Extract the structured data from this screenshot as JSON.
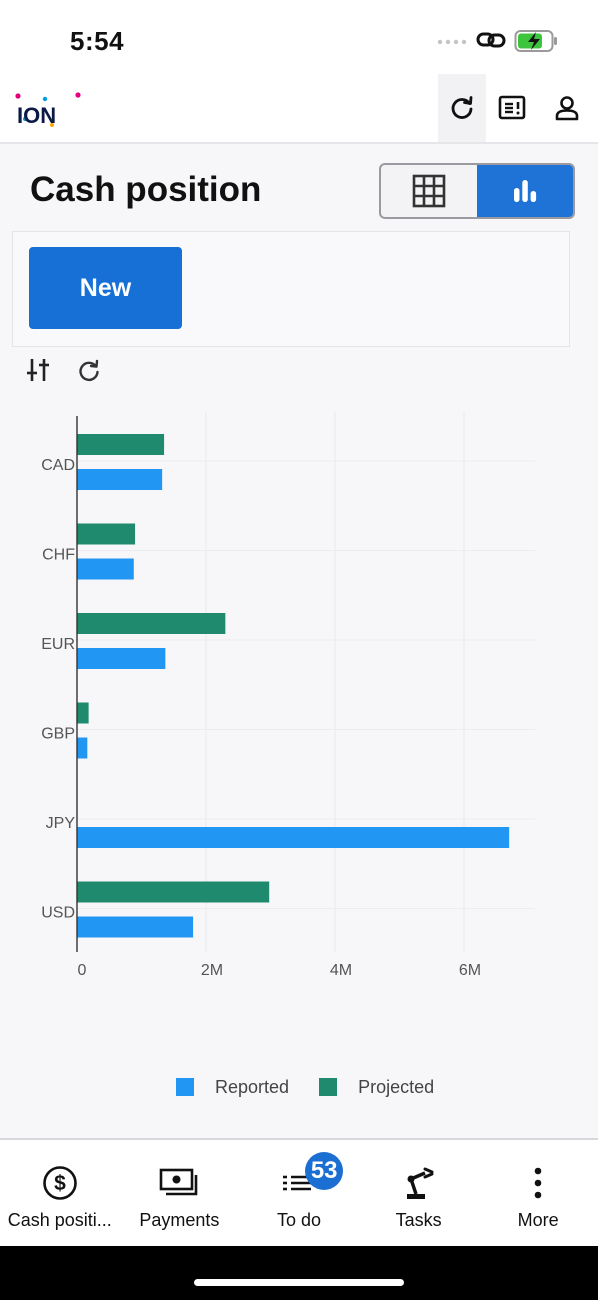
{
  "status": {
    "time": "5:54"
  },
  "header": {
    "logo_text": "ION"
  },
  "page": {
    "title": "Cash position",
    "new_label": "New"
  },
  "colors": {
    "reported": "#2196f3",
    "projected": "#1f8a6e",
    "accent": "#1670d6"
  },
  "chart_data": {
    "type": "bar",
    "orientation": "horizontal",
    "categories": [
      "CAD",
      "CHF",
      "EUR",
      "GBP",
      "JPY",
      "USD"
    ],
    "series": [
      {
        "name": "Projected",
        "values": [
          1350000,
          900000,
          2300000,
          180000,
          0,
          2980000
        ]
      },
      {
        "name": "Reported",
        "values": [
          1320000,
          880000,
          1370000,
          160000,
          6700000,
          1800000
        ]
      }
    ],
    "xticks": [
      {
        "value": 0,
        "label": "0"
      },
      {
        "value": 2000000,
        "label": "2M"
      },
      {
        "value": 4000000,
        "label": "4M"
      },
      {
        "value": 6000000,
        "label": "6M"
      }
    ],
    "xlim": [
      0,
      7000000
    ],
    "grid": true,
    "legend_position": "bottom"
  },
  "legend": [
    {
      "label": "Reported",
      "color": "#2196f3"
    },
    {
      "label": "Projected",
      "color": "#1f8a6e"
    }
  ],
  "bottom_nav": {
    "items": [
      {
        "label": "Cash positi...",
        "icon": "dollar-circle-icon"
      },
      {
        "label": "Payments",
        "icon": "payments-icon"
      },
      {
        "label": "To do",
        "icon": "todo-list-icon",
        "badge": "53"
      },
      {
        "label": "Tasks",
        "icon": "robot-arm-icon"
      },
      {
        "label": "More",
        "icon": "more-vertical-icon"
      }
    ]
  }
}
